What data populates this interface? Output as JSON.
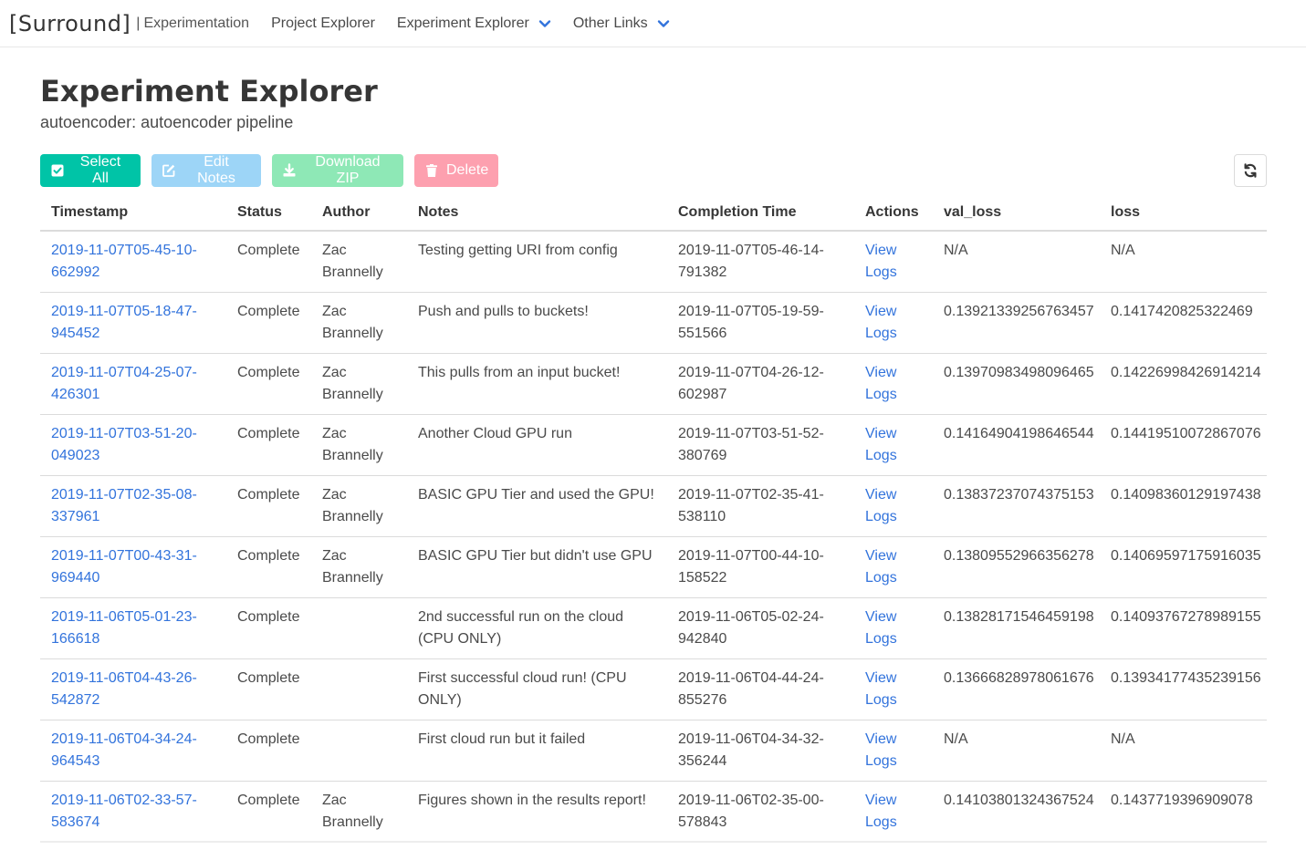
{
  "navbar": {
    "brand": "[Surround]",
    "separator": "|",
    "brand_sub": "Experimentation",
    "items": [
      {
        "label": "Project Explorer"
      },
      {
        "label": "Experiment Explorer"
      },
      {
        "label": "Other Links"
      }
    ]
  },
  "page": {
    "title": "Experiment Explorer",
    "subtitle": "autoencoder: autoencoder pipeline"
  },
  "toolbar": {
    "select_all": "Select All",
    "edit_notes": "Edit Notes",
    "download_zip": "Download ZIP",
    "delete": "Delete"
  },
  "colors": {
    "accent_link": "#3273dc",
    "select_all": "#00c4a7",
    "edit_notes": "#9dd5f7",
    "download": "#8ee8b6",
    "delete": "#fda0af"
  },
  "table": {
    "columns": [
      "Timestamp",
      "Status",
      "Author",
      "Notes",
      "Completion Time",
      "Actions",
      "val_loss",
      "loss"
    ],
    "rows": [
      {
        "timestamp": "2019-11-07T05-45-10-662992",
        "status": "Complete",
        "author": "Zac Brannelly",
        "notes": "Testing getting URI from config",
        "completion": "2019-11-07T05-46-14-791382",
        "view": "View",
        "logs": "Logs",
        "val_loss": "N/A",
        "loss": "N/A"
      },
      {
        "timestamp": "2019-11-07T05-18-47-945452",
        "status": "Complete",
        "author": "Zac Brannelly",
        "notes": "Push and pulls to buckets!",
        "completion": "2019-11-07T05-19-59-551566",
        "view": "View",
        "logs": "Logs",
        "val_loss": "0.13921339256763457",
        "loss": "0.1417420825322469"
      },
      {
        "timestamp": "2019-11-07T04-25-07-426301",
        "status": "Complete",
        "author": "Zac Brannelly",
        "notes": "This pulls from an input bucket!",
        "completion": "2019-11-07T04-26-12-602987",
        "view": "View",
        "logs": "Logs",
        "val_loss": "0.13970983498096465",
        "loss": "0.14226998426914214"
      },
      {
        "timestamp": "2019-11-07T03-51-20-049023",
        "status": "Complete",
        "author": "Zac Brannelly",
        "notes": "Another Cloud GPU run",
        "completion": "2019-11-07T03-51-52-380769",
        "view": "View",
        "logs": "Logs",
        "val_loss": "0.14164904198646544",
        "loss": "0.14419510072867076"
      },
      {
        "timestamp": "2019-11-07T02-35-08-337961",
        "status": "Complete",
        "author": "Zac Brannelly",
        "notes": "BASIC GPU Tier and used the GPU!",
        "completion": "2019-11-07T02-35-41-538110",
        "view": "View",
        "logs": "Logs",
        "val_loss": "0.13837237074375153",
        "loss": "0.14098360129197438"
      },
      {
        "timestamp": "2019-11-07T00-43-31-969440",
        "status": "Complete",
        "author": "Zac Brannelly",
        "notes": "BASIC GPU Tier but didn't use GPU",
        "completion": "2019-11-07T00-44-10-158522",
        "view": "View",
        "logs": "Logs",
        "val_loss": "0.13809552966356278",
        "loss": "0.14069597175916035"
      },
      {
        "timestamp": "2019-11-06T05-01-23-166618",
        "status": "Complete",
        "author": "",
        "notes": "2nd successful run on the cloud (CPU ONLY)",
        "completion": "2019-11-06T05-02-24-942840",
        "view": "View",
        "logs": "Logs",
        "val_loss": "0.13828171546459198",
        "loss": "0.14093767278989155"
      },
      {
        "timestamp": "2019-11-06T04-43-26-542872",
        "status": "Complete",
        "author": "",
        "notes": "First successful cloud run! (CPU ONLY)",
        "completion": "2019-11-06T04-44-24-855276",
        "view": "View",
        "logs": "Logs",
        "val_loss": "0.13666828978061676",
        "loss": "0.13934177435239156"
      },
      {
        "timestamp": "2019-11-06T04-34-24-964543",
        "status": "Complete",
        "author": "",
        "notes": "First cloud run but it failed",
        "completion": "2019-11-06T04-34-32-356244",
        "view": "View",
        "logs": "Logs",
        "val_loss": "N/A",
        "loss": "N/A"
      },
      {
        "timestamp": "2019-11-06T02-33-57-583674",
        "status": "Complete",
        "author": "Zac Brannelly",
        "notes": "Figures shown in the results report!",
        "completion": "2019-11-06T02-35-00-578843",
        "view": "View",
        "logs": "Logs",
        "val_loss": "0.14103801324367524",
        "loss": "0.1437719396909078"
      }
    ]
  }
}
